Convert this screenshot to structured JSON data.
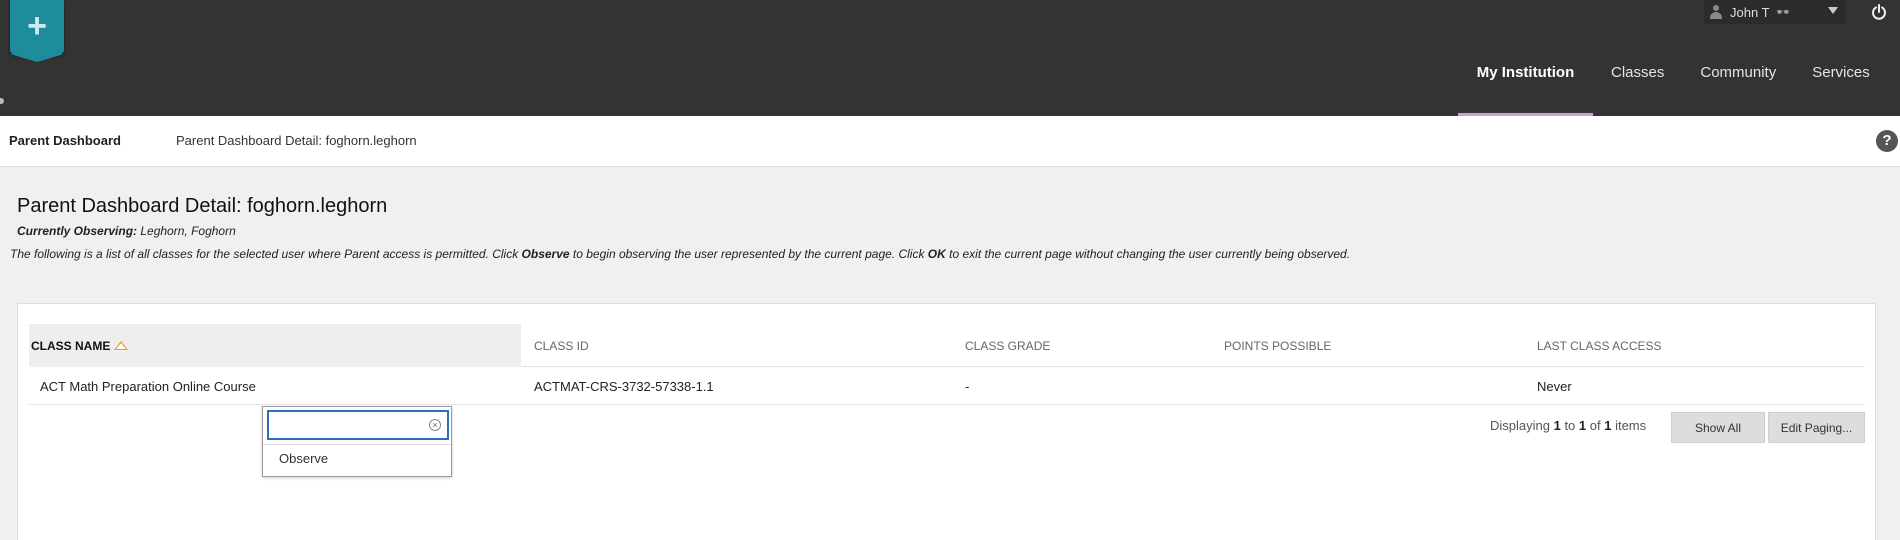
{
  "header": {
    "logo_icon": "plus-icon",
    "user_name": "John T",
    "user_glasses_glyph": "👓",
    "nav": [
      {
        "label": "My Institution",
        "active": true
      },
      {
        "label": "Classes",
        "active": false
      },
      {
        "label": "Community",
        "active": false
      },
      {
        "label": "Services",
        "active": false
      }
    ]
  },
  "breadcrumb": {
    "root": "Parent Dashboard",
    "current": "Parent Dashboard Detail: foghorn.leghorn",
    "help": "?"
  },
  "page": {
    "title": "Parent Dashboard Detail: foghorn.leghorn",
    "observing_label": "Currently Observing:",
    "observing_value": " Leghorn, Foghorn",
    "instructions_part1": "The following is a list of all classes for the selected user where Parent access is permitted. Click ",
    "instructions_bold1": "Observe",
    "instructions_part2": " to begin observing the user represented by the current page. Click ",
    "instructions_bold2": "OK",
    "instructions_part3": " to exit the current page without changing the user currently being observed."
  },
  "table": {
    "columns": [
      "CLASS NAME",
      "CLASS ID",
      "CLASS GRADE",
      "POINTS POSSIBLE",
      "LAST CLASS ACCESS"
    ],
    "rows": [
      {
        "class_name": "ACT Math Preparation Online Course",
        "class_id": "ACTMAT-CRS-3732-57338-1.1",
        "class_grade": "-",
        "points_possible": "",
        "last_access": "Never"
      }
    ]
  },
  "paging": {
    "prefix": "Displaying ",
    "from": "1",
    "to_word": " to ",
    "to": "1",
    "of_word": " of ",
    "total": "1",
    "suffix": " items",
    "show_all": "Show All",
    "edit_paging": "Edit Paging..."
  },
  "context_menu": {
    "search_value": "",
    "clear_glyph": "×",
    "items": [
      "Observe"
    ]
  },
  "colors": {
    "header_bg": "#333333",
    "logo_teal": "#1f8c9e",
    "active_underline": "#c9a0dc",
    "sort_arrow": "#e39a1f",
    "focus_blue": "#2a6fb8"
  }
}
